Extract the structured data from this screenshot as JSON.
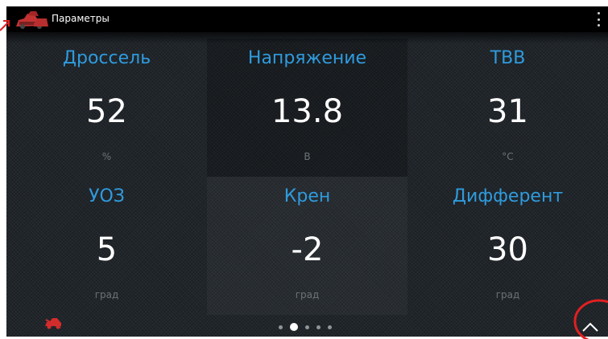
{
  "app": {
    "title": "Параметры"
  },
  "metrics": [
    {
      "label": "Дроссель",
      "value": "52",
      "unit": "%"
    },
    {
      "label": "Напряжение",
      "value": "13.8",
      "unit": "В"
    },
    {
      "label": "ТВВ",
      "value": "31",
      "unit": "°С"
    },
    {
      "label": "УОЗ",
      "value": "5",
      "unit": "град"
    },
    {
      "label": "Крен",
      "value": "-2",
      "unit": "град"
    },
    {
      "label": "Дифферент",
      "value": "30",
      "unit": "град"
    }
  ],
  "pager": {
    "pages": 5,
    "active": 2
  },
  "colors": {
    "label": "#2f9bdd",
    "value": "#ffffff",
    "unit": "#6c7378",
    "background": "#20252a",
    "topbar": "#000000",
    "annotation": "#e02020"
  },
  "icons": {
    "app": "car-cluster-icon",
    "status": "car-status-icon",
    "menu": "overflow-menu-icon",
    "up": "chevron-up-icon"
  }
}
